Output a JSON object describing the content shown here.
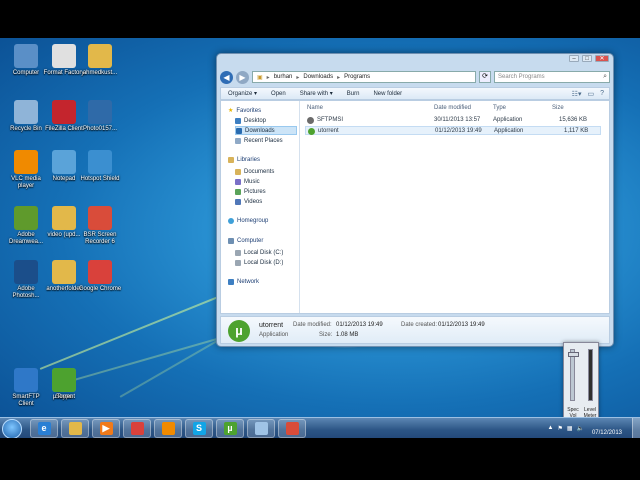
{
  "desktop": {
    "icons": [
      {
        "label": "Computer",
        "icon": "computer-icon",
        "color": "#5a8fc7"
      },
      {
        "label": "Format Factory",
        "icon": "format-factory-icon",
        "color": "#e0e0e0"
      },
      {
        "label": "ahmedkust...",
        "icon": "folder-icon",
        "color": "#e2b84a"
      },
      {
        "label": "Recycle Bin",
        "icon": "recycle-bin-icon",
        "color": "#8fb4d8"
      },
      {
        "label": "FileZilla Client",
        "icon": "filezilla-icon",
        "color": "#c4252d"
      },
      {
        "label": "Photo0157...",
        "icon": "photo-icon",
        "color": "#2f6aa8"
      },
      {
        "label": "VLC media player",
        "icon": "vlc-icon",
        "color": "#f08a00"
      },
      {
        "label": "Notepad",
        "icon": "notepad-icon",
        "color": "#5aa3d9"
      },
      {
        "label": "Hotspot Shield",
        "icon": "hotspot-shield-icon",
        "color": "#3b8fd0"
      },
      {
        "label": "Adobe Dreamwea...",
        "icon": "dreamweaver-icon",
        "color": "#5f9a2c"
      },
      {
        "label": "video (upd...",
        "icon": "folder-icon",
        "color": "#e2b84a"
      },
      {
        "label": "BSR Screen Recorder 6",
        "icon": "bsr-recorder-icon",
        "color": "#d94c3a"
      },
      {
        "label": "Adobe Photosh...",
        "icon": "photoshop-icon",
        "color": "#1b4e8a"
      },
      {
        "label": "anotherfolder",
        "icon": "folder-icon",
        "color": "#e2b84a"
      },
      {
        "label": "Google Chrome",
        "icon": "chrome-icon",
        "color": "#d9413b"
      },
      {
        "label": "SmartFTP Client",
        "icon": "smartftp-icon",
        "color": "#2f78c8"
      },
      {
        "label": "Skype",
        "icon": "skype-icon",
        "color": "#12a5e6"
      },
      {
        "label": "µTorrent",
        "icon": "utorrent-icon",
        "color": "#4da22f"
      }
    ]
  },
  "window": {
    "address": [
      "burhan",
      "Downloads",
      "Programs"
    ],
    "search_placeholder": "Search Programs",
    "toolbar": {
      "organize": "Organize ▾",
      "open": "Open",
      "share_with": "Share with ▾",
      "burn": "Burn",
      "new_folder": "New folder"
    },
    "nav": {
      "favorites": "Favorites",
      "favorites_items": [
        "Desktop",
        "Downloads",
        "Recent Places"
      ],
      "libraries": "Libraries",
      "libraries_items": [
        "Documents",
        "Music",
        "Pictures",
        "Videos"
      ],
      "homegroup": "Homegroup",
      "computer": "Computer",
      "computer_items": [
        "Local Disk (C:)",
        "Local Disk (D:)"
      ],
      "network": "Network"
    },
    "columns": [
      "Name",
      "Date modified",
      "Type",
      "Size"
    ],
    "files": [
      {
        "name": "SFTPMSI",
        "date": "30/11/2013 13:57",
        "type": "Application",
        "size": "15,636 KB",
        "icon_color": "#6b6b6b"
      },
      {
        "name": "utorrent",
        "date": "01/12/2013 19:49",
        "type": "Application",
        "size": "1,117 KB",
        "icon_color": "#4da22f"
      }
    ],
    "details": {
      "name": "utorrent",
      "type": "Application",
      "modified_label": "Date modified:",
      "modified": "01/12/2013 19:49",
      "created_label": "Date created:",
      "created": "01/12/2013 19:49",
      "size_label": "Size:",
      "size": "1.08 MB"
    }
  },
  "mixer": {
    "labels": [
      "Spec Vol",
      "Level Meter"
    ]
  },
  "taskbar": {
    "apps": [
      {
        "icon": "internet-explorer-icon",
        "color": "#2a7fd4",
        "glyph": "e"
      },
      {
        "icon": "folder-icon",
        "color": "#e2b84a",
        "glyph": ""
      },
      {
        "icon": "media-player-icon",
        "color": "#f07a1a",
        "glyph": "▶"
      },
      {
        "icon": "chrome-icon",
        "color": "#d9413b",
        "glyph": ""
      },
      {
        "icon": "vlc-icon",
        "color": "#f08a00",
        "glyph": ""
      },
      {
        "icon": "skype-icon",
        "color": "#12a5e6",
        "glyph": "S"
      },
      {
        "icon": "utorrent-icon",
        "color": "#4da22f",
        "glyph": "µ"
      },
      {
        "icon": "explorer-window-icon",
        "color": "#9fc3e6",
        "glyph": ""
      },
      {
        "icon": "bsr-recorder-icon",
        "color": "#d94c3a",
        "glyph": ""
      }
    ],
    "time": "",
    "date": "07/12/2013"
  }
}
